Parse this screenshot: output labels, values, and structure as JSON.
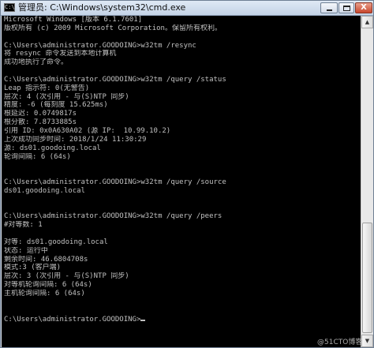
{
  "window": {
    "title": "管理员: C:\\Windows\\system32\\cmd.exe",
    "icon_text": "C:\\",
    "close_glyph": "X"
  },
  "console": {
    "lines": [
      "Microsoft Windows [版本 6.1.7601]",
      "版权所有 (c) 2009 Microsoft Corporation。保留所有权利。",
      "",
      "C:\\Users\\administrator.GOODOING>w32tm /resync",
      "将 resync 命令发送到本地计算机",
      "成功地执行了命令。",
      "",
      "C:\\Users\\administrator.GOODOING>w32tm /query /status",
      "Leap 指示符: 0(无警告)",
      "层次: 4 (次引用 - 与(S)NTP 同步)",
      "精度: -6 (每刻度 15.625ms)",
      "根延迟: 0.0749817s",
      "根分散: 7.8733885s",
      "引用 ID: 0x0A630A02 (源 IP:  10.99.10.2)",
      "上次成功同步时间: 2018/1/24 11:30:29",
      "源: ds01.goodoing.local",
      "轮询间隔: 6 (64s)",
      "",
      "",
      "C:\\Users\\administrator.GOODOING>w32tm /query /source",
      "ds01.goodoing.local",
      "",
      "",
      "C:\\Users\\administrator.GOODOING>w32tm /query /peers",
      "#对等数: 1",
      "",
      "对等: ds01.goodoing.local",
      "状态: 运行中",
      "剩余时间: 46.6804708s",
      "模式:3 (客户端)",
      "层次: 3 (次引用 - 与(S)NTP 同步)",
      "对等机轮询间隔: 6 (64s)",
      "主机轮询间隔: 6 (64s)",
      "",
      "",
      "C:\\Users\\administrator.GOODOING>"
    ]
  },
  "watermark": "@51CTO博客"
}
